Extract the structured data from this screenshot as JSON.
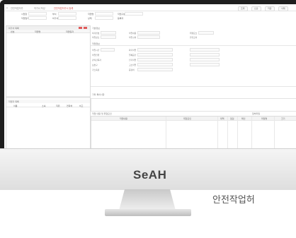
{
  "app": {
    "breadcrumb": [
      "안전작업허가",
      "허가서 작성",
      "안전작업허가서 등록"
    ],
    "toolbar_buttons": [
      "조회",
      "신규",
      "저장",
      "삭제"
    ]
  },
  "filters": {
    "labels": [
      "사업장",
      "부서",
      "작업일자",
      "허가서번호",
      "작업명",
      "작업구분",
      "상태",
      "등록자"
    ]
  },
  "left_panel": {
    "title": "허가서 목록",
    "columns": [
      "번호",
      "작업명",
      "작업일자"
    ],
    "bottom_title": "작업자 목록",
    "bottom_columns": [
      "이름",
      "소속",
      "직위",
      "연락처",
      "비고"
    ]
  },
  "main": {
    "section1_title": "기본정보",
    "section2_title": "작업정보",
    "field_labels": [
      "허가번호",
      "작업장소",
      "작업내용",
      "작업구분",
      "위험요소",
      "안전조치",
      "작업시간",
      "작업인원",
      "관리감독자",
      "보호구",
      "가스측정",
      "화기작업",
      "밀폐공간",
      "전기작업",
      "고소작업",
      "중장비"
    ],
    "memo_title": "기타 특이사항",
    "bottom_title": "작업 내용 및 위험요인",
    "bottom_columns": [
      "작업내용",
      "위험요인",
      "대책",
      "점검",
      "확인"
    ],
    "right_title": "첨부파일",
    "right_columns": [
      "파일명",
      "크기"
    ]
  },
  "monitor": {
    "brand": "SeAH",
    "caption": "안전작업허"
  }
}
